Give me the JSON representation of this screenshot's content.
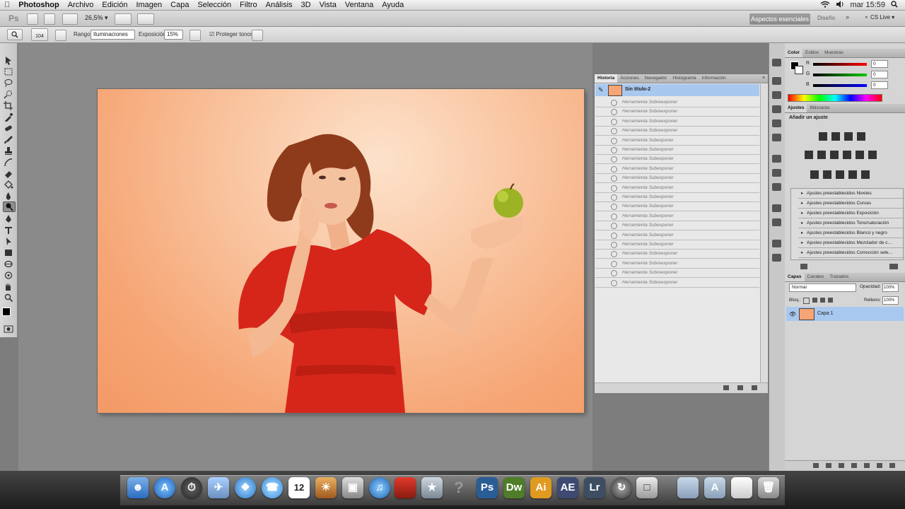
{
  "menubar": {
    "app": "Photoshop",
    "items": [
      "Archivo",
      "Edición",
      "Imagen",
      "Capa",
      "Selección",
      "Filtro",
      "Análisis",
      "3D",
      "Vista",
      "Ventana",
      "Ayuda"
    ],
    "clock": "mar 15:59"
  },
  "appbar": {
    "zoom": "26,5",
    "workspace_label": "Aspectos esenciales",
    "design_label": "Diseño",
    "cslive_label": "CS Live"
  },
  "options": {
    "brush_size": "104",
    "range_label": "Rango:",
    "range_value": "Iluminaciones",
    "exposure_label": "Exposición:",
    "exposure_value": "15%",
    "protect_label": "Proteger tonos"
  },
  "history": {
    "tabs": [
      "Historia",
      "Acciones",
      "Navegador",
      "Histograma",
      "Información"
    ],
    "snapshot_label": "Sin título-2",
    "steps": [
      "Herramienta Sobreexponer",
      "Herramienta Sobreexponer",
      "Herramienta Sobreexponer",
      "Herramienta Sobreexponer",
      "Herramienta Subexponer",
      "Herramienta Subexponer",
      "Herramienta Subexponer",
      "Herramienta Subexponer",
      "Herramienta Subexponer",
      "Herramienta Subexponer",
      "Herramienta Subexponer",
      "Herramienta Subexponer",
      "Herramienta Subexponer",
      "Herramienta Subexponer",
      "Herramienta Subexponer",
      "Herramienta Subexponer",
      "Herramienta Sobreexponer",
      "Herramienta Sobreexponer",
      "Herramienta Sobreexponer",
      "Herramienta Sobreexponer"
    ]
  },
  "color_panel": {
    "tabs": [
      "Color",
      "Estilos",
      "Muestras"
    ],
    "r_label": "R",
    "g_label": "G",
    "b_label": "B",
    "r": "0",
    "g": "0",
    "b": "0"
  },
  "adjustments": {
    "tabs": [
      "Ajustes",
      "Máscaras"
    ],
    "add_label": "Añadir un ajuste",
    "presets": [
      "Ajustes preestablecidos Niveles",
      "Ajustes preestablecidos Curvas",
      "Ajustes preestablecidos Exposición",
      "Ajustes preestablecidos Tono/saturación",
      "Ajustes preestablecidos Blanco y negro",
      "Ajustes preestablecidos Mezclador de c...",
      "Ajustes preestablecidos Corrección sele..."
    ]
  },
  "layers": {
    "tabs": [
      "Capas",
      "Canales",
      "Trazados"
    ],
    "blend_mode": "Normal",
    "opacity_label": "Opacidad:",
    "opacity": "100%",
    "lock_label": "Bloq.:",
    "fill_label": "Relleno:",
    "fill": "100%",
    "layer_name": "Capa 1"
  },
  "dock": {
    "ps": "Ps",
    "dw": "Dw",
    "ai": "Ai",
    "ae": "AE",
    "lr": "Lr",
    "calendar_day": "12"
  },
  "colors": {
    "accent": "#a9c8ef",
    "ps": "#2a5c96",
    "dw": "#4f7d2a",
    "ai": "#e09a1f",
    "ae": "#3e4a72",
    "lr": "#3d4e63"
  }
}
